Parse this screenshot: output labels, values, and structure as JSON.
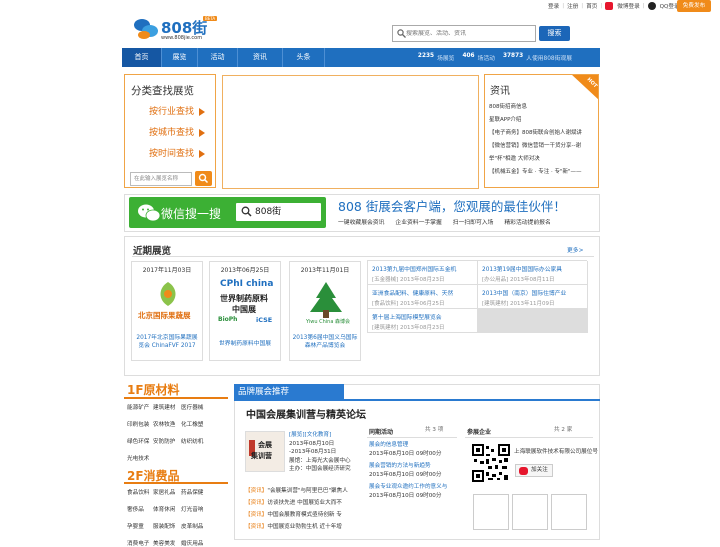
{
  "topbar": {
    "login": "登录",
    "register": "注册",
    "home": "首页",
    "weibo_login": "微博登录",
    "qq_login": "QQ登录",
    "publish": "免费发布"
  },
  "logo": {
    "brand": "808街",
    "site": "www.808jie.com",
    "tag": "BETA"
  },
  "search": {
    "placeholder": "搜索展览、活动、资讯",
    "button": "搜索"
  },
  "nav": {
    "items": [
      "首页",
      "展览",
      "活动",
      "资讯",
      "头条"
    ],
    "stat1_num": "2235",
    "stat1_label": "场展览",
    "stat2_num": "406",
    "stat2_label": "场活动",
    "stat3_num": "37873",
    "stat3_label": "人使用808街观展"
  },
  "category": {
    "title": "分类查找展览",
    "links": [
      "按行业查找",
      "按城市查找",
      "按时间查找"
    ],
    "input_placeholder": "在此输入展览名称"
  },
  "news": {
    "title": "资讯",
    "items": [
      "808街招商信息",
      "星联APP介绍",
      "【电子商务】808街联合创始人谢斌讲",
      "【微信营销】微信营销一干货分享--谢",
      "举\"杯\"相邀 大师对决",
      "【机械五金】专业 · 专注 · 专\"新\"——"
    ],
    "badge": "HOT"
  },
  "wechat": {
    "label": "微信搜一搜",
    "keyword": "808街",
    "slogan": "808 街展会客户端，您观展的最佳伙伴！",
    "features": [
      "一键收藏展会资讯",
      "企业资料一手掌握",
      "扫一扫即可入场",
      "精彩活动提前报名"
    ]
  },
  "recent": {
    "title": "近期展览",
    "more": "更多>",
    "cards": [
      {
        "date": "2017年11月03日",
        "title": "2017年北京国际果蔬展览会 ChinaFVF 2017",
        "logo": "北京国际果蔬展"
      },
      {
        "date": "2013年06月25日",
        "title": "世界制药原料中国展",
        "logo1": "CPhI china",
        "logo2": "世界制药原料",
        "logo3": "中国展",
        "logo4": "BioPh",
        "logo5": "iCSE"
      },
      {
        "date": "2013年11月01日",
        "title": "2013第6届中国义乌国际森林产品博览会",
        "logo": "Yiwu China 森博会"
      }
    ],
    "grid": [
      {
        "a": "2013第九届中国郑州国际五金机",
        "b": "[五金器械] 2013年08月23日"
      },
      {
        "a": "2013第19届中国国际办公家具",
        "b": "[办公用品] 2013年08月11日"
      },
      {
        "a": "亚洲食品配料、健康原料、天然",
        "b": "[食品饮料] 2013年06月25日"
      },
      {
        "a": "2013中国（南京）国际住博产业",
        "b": "[建筑建材] 2013年11月09日"
      },
      {
        "a": "第十届上海国际模型展览会",
        "b": "[建筑建材] 2013年08月23日"
      }
    ]
  },
  "floor1": {
    "title": "1F原材料",
    "items": [
      "能源矿产",
      "建筑建材",
      "医疗器械",
      "印刷包装",
      "农林牧渔",
      "化工橡塑",
      "绿色环保",
      "安防防护",
      "纺织纺机",
      "光电技术"
    ]
  },
  "floor2": {
    "title": "2F消费品",
    "items": [
      "食品饮料",
      "家居礼品",
      "药品保健",
      "奢侈品",
      "体育休闲",
      "灯光音响",
      "孕婴童",
      "服装配饰",
      "皮革制品",
      "消费电子",
      "美容美发",
      "婚庆用品"
    ]
  },
  "brand": {
    "header": "品牌展会推荐",
    "forum_title": "中国会展集训营与精英论坛",
    "forum_tag": "[展览][文化教育]",
    "forum_logo1": "会展",
    "forum_logo2": "集训营",
    "forum_date1": "2013年08月10日",
    "forum_date2": "-2013年08月31日",
    "forum_host": "展馆：上海光大会展中心",
    "forum_org": "主办：中国会展经济研究",
    "news": [
      {
        "tag": "【资讯】",
        "text": "\"会展集训营\"与阿里巴巴\"聚焦人"
      },
      {
        "tag": "【资讯】",
        "text": "访谈扶先进 中国展览业大而不"
      },
      {
        "tag": "【资讯】",
        "text": "中国会展教育模式亟待创新 专"
      },
      {
        "tag": "【资讯】",
        "text": "中国展览业勃勃生机 近十年增"
      }
    ],
    "activity": {
      "title": "同期活动",
      "page": "共 3 项",
      "items": [
        {
          "t": "展会的信息管理",
          "d": "2013年08月10日 09时00分"
        },
        {
          "t": "展会营销的方法与新趋势",
          "d": "2013年08月10日 09时00分"
        },
        {
          "t": "展会专业观众邀约工作的意义与",
          "d": "2013年08月10日 09时00分"
        }
      ]
    },
    "company": {
      "title": "参展企业",
      "page": "共 2 家",
      "name": "上海联展软件技术有限公司",
      "follow": "加关注",
      "badge": "展位号"
    }
  }
}
